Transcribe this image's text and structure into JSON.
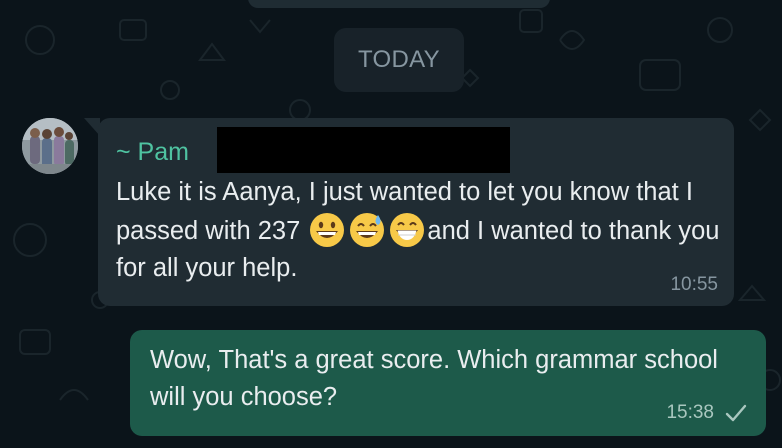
{
  "chat": {
    "date_divider": "TODAY",
    "incoming": {
      "sender": "~ Pam",
      "text_part1": "Luke it is Aanya, I just wanted to let you know that I passed with 237",
      "text_part2": "and I wanted to thank you for all your help.",
      "emojis": [
        "grinning-face-icon",
        "grinning-sweat-icon",
        "beaming-face-icon"
      ],
      "time": "10:55"
    },
    "outgoing": {
      "text": "Wow, That's a great score. Which grammar school will you choose?",
      "time": "15:38",
      "status_icon": "single-check-icon"
    }
  },
  "colors": {
    "background": "#0b141a",
    "incoming_bubble": "#202c33",
    "outgoing_bubble": "#1d5a4a",
    "sender_name": "#4fc3a1"
  }
}
